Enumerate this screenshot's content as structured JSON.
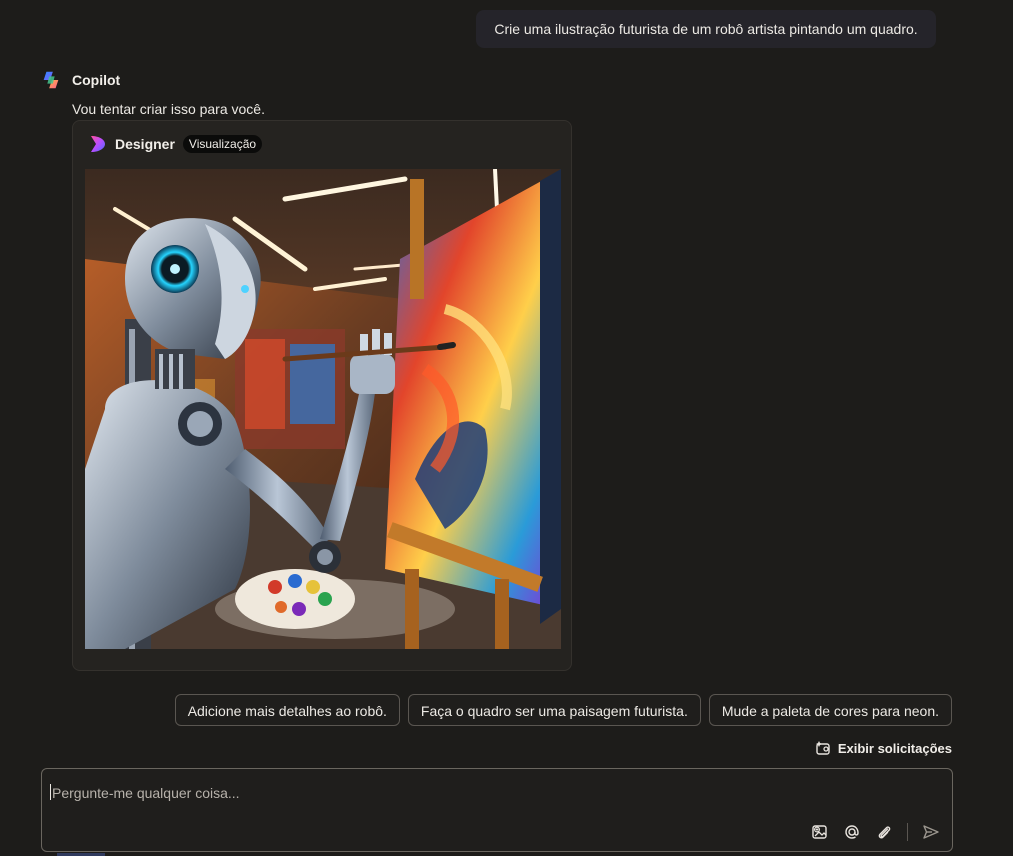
{
  "user_message": "Crie uma ilustração futurista de um robô artista pintando um quadro.",
  "bot": {
    "name": "Copilot",
    "reply": "Vou tentar criar isso para você."
  },
  "designer_card": {
    "name": "Designer",
    "badge": "Visualização",
    "image_icon": "robot-painter-image"
  },
  "suggestions": [
    {
      "label": "Adicione mais detalhes ao robô."
    },
    {
      "label": "Faça o quadro ser uma paisagem futurista."
    },
    {
      "label": "Mude a paleta de cores para neon."
    }
  ],
  "show_prompts_label": "Exibir solicitações",
  "composer": {
    "placeholder": "Pergunte-me qualquer coisa...",
    "tools": [
      "add-image-icon",
      "mention-icon",
      "attach-icon",
      "send-icon"
    ]
  },
  "colors": {
    "background": "#1d1c1a",
    "user_bubble": "#25242a",
    "card": "#252320",
    "badge": "#0b0b0a"
  }
}
